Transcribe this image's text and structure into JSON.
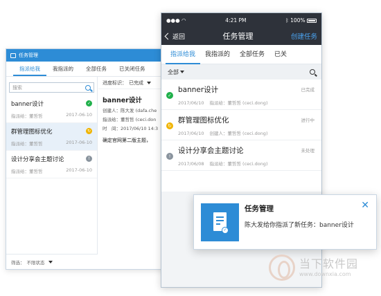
{
  "desktop": {
    "title": "任务管理",
    "tabs": [
      "指派给我",
      "我指派的",
      "全部任务",
      "已关闭任务"
    ],
    "search_placeholder": "搜索",
    "items": [
      {
        "title": "banner设计",
        "assignee": "指派给：董哲哲",
        "date": "2017-06-10",
        "status": "done",
        "color": "#20b04b",
        "glyph": "✓"
      },
      {
        "title": "群管理图标优化",
        "assignee": "指派给：董哲哲",
        "date": "2017-06-10",
        "status": "in-progress",
        "color": "#f0b400",
        "glyph": "↻"
      },
      {
        "title": "设计分享会主题讨论",
        "assignee": "指派给：董哲哲",
        "date": "2017-06-10",
        "status": "pending",
        "color": "#8a949e",
        "glyph": "!"
      }
    ],
    "filter_label": "筛选：",
    "filter_value": "不限状态",
    "detail": {
      "progress_label": "进度标识：",
      "progress_value": "已完成",
      "title": "banner设计",
      "creator": "创建人：陈大发 (dafa.che",
      "assignee": "指派给：董哲哲 (ceci.don",
      "time": "时　间：2017/06/10 14:3",
      "desc": "确定官网第二版主题，"
    }
  },
  "phone": {
    "time": "4:21 PM",
    "battery": "100%",
    "back": "返回",
    "title": "任务管理",
    "action": "创建任务",
    "tabs": [
      "指派给我",
      "我指派的",
      "全部任务",
      "已关"
    ],
    "filter": "全部",
    "items": [
      {
        "title": "banner设计",
        "date": "2017/06/10",
        "person": "指派给：董哲哲 (ceci.dong)",
        "state": "已完成",
        "color": "#20b04b",
        "glyph": "✓"
      },
      {
        "title": "群管理图标优化",
        "date": "2017/06/10",
        "person": "创建人：董哲哲 (ceci.dong)",
        "state": "进行中",
        "color": "#f0b400",
        "glyph": "↻"
      },
      {
        "title": "设计分享会主题讨论",
        "date": "2017/06/08",
        "person": "指派给：董哲哲 (ceci.dong)",
        "state": "未处理",
        "color": "#8a949e",
        "glyph": "!"
      }
    ]
  },
  "notification": {
    "title": "任务管理",
    "message": "陈大发给你指派了新任务：banner设计"
  },
  "watermark": {
    "text": "当下软件园",
    "url": "www.downxia.com"
  }
}
